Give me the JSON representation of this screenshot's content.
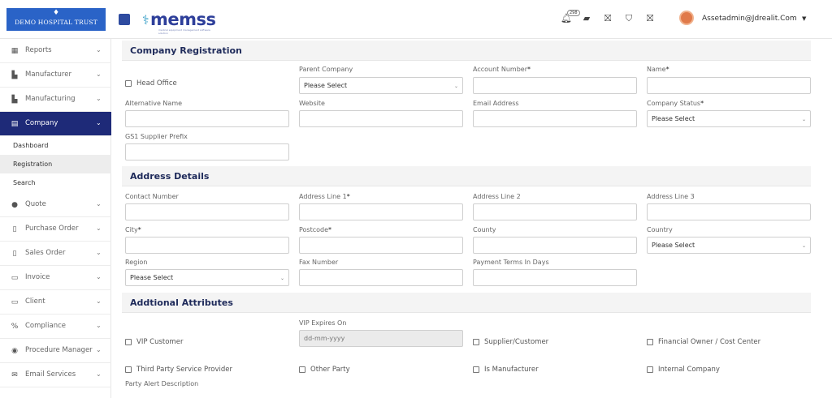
{
  "header": {
    "hospital_logo": "DEMO HOSPITAL TRUST",
    "brand": "memss",
    "brand_tagline": "medical equipment management software solution",
    "notification_count": "298",
    "user_name": "Assetadmin@Jdrealit.Com"
  },
  "sidebar": {
    "items": [
      {
        "label": "Reports",
        "icon": "report-icon"
      },
      {
        "label": "Manufacturer",
        "icon": "factory-icon"
      },
      {
        "label": "Manufacturing",
        "icon": "factory-icon"
      },
      {
        "label": "Company",
        "icon": "building-icon"
      },
      {
        "label": "Quote",
        "icon": "quote-icon"
      },
      {
        "label": "Purchase Order",
        "icon": "document-icon"
      },
      {
        "label": "Sales Order",
        "icon": "document-icon"
      },
      {
        "label": "Invoice",
        "icon": "invoice-icon"
      },
      {
        "label": "Client",
        "icon": "client-icon"
      },
      {
        "label": "Compliance",
        "icon": "compliance-icon"
      },
      {
        "label": "Procedure Manager",
        "icon": "procedure-icon"
      },
      {
        "label": "Email Services",
        "icon": "mail-icon"
      }
    ],
    "company_sub": [
      "Dashboard",
      "Registration",
      "Search"
    ]
  },
  "company_registration": {
    "title": "Company Registration",
    "head_office": "Head Office",
    "parent_company_label": "Parent Company",
    "parent_company_value": "Please Select",
    "account_number_label": "Account Number",
    "name_label": "Name",
    "alternative_name_label": "Alternative Name",
    "website_label": "Website",
    "email_label": "Email Address",
    "company_status_label": "Company Status",
    "company_status_value": "Please Select",
    "gs1_label": "GS1 Supplier Prefix"
  },
  "address_details": {
    "title": "Address Details",
    "contact_number_label": "Contact Number",
    "address1_label": "Address Line 1",
    "address2_label": "Address Line 2",
    "address3_label": "Address Line 3",
    "city_label": "City",
    "postcode_label": "Postcode",
    "county_label": "County",
    "country_label": "Country",
    "country_value": "Please Select",
    "region_label": "Region",
    "region_value": "Please Select",
    "fax_label": "Fax Number",
    "payment_terms_label": "Payment Terms In Days"
  },
  "additional_attributes": {
    "title": "Addtional Attributes",
    "vip_customer": "VIP Customer",
    "vip_expires_label": "VIP Expires On",
    "vip_expires_placeholder": "dd-mm-yyyy",
    "supplier_customer": "Supplier/Customer",
    "financial_owner": "Financial Owner / Cost Center",
    "third_party": "Third Party Service Provider",
    "other_party": "Other Party",
    "is_manufacturer": "Is Manufacturer",
    "internal_company": "Internal Company",
    "party_alert_label": "Party Alert Description"
  },
  "required_marker": "*"
}
